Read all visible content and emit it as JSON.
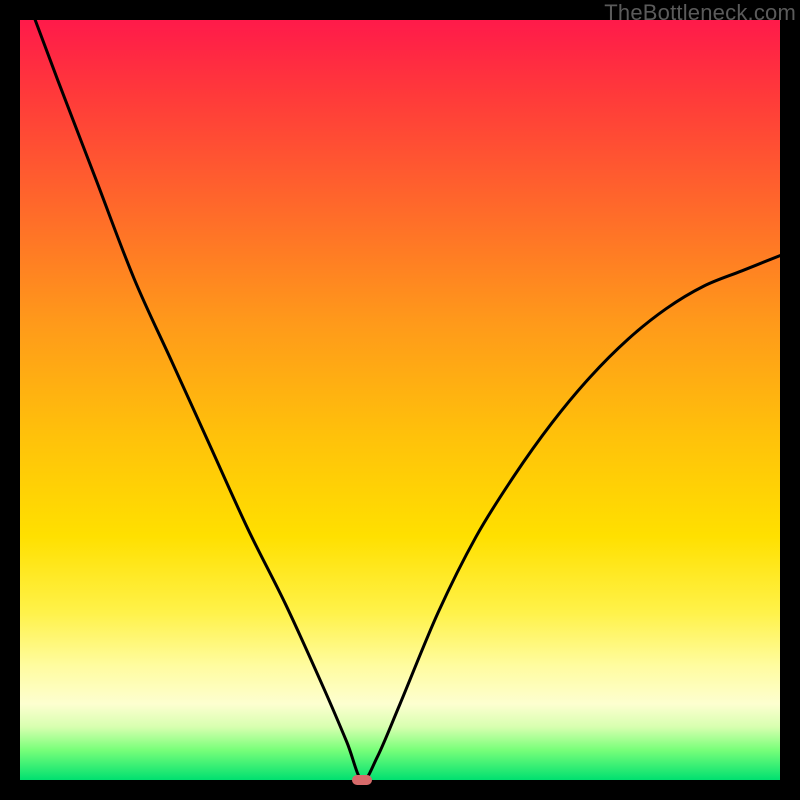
{
  "watermark": "TheBottleneck.com",
  "colors": {
    "frame": "#000000",
    "curve": "#000000",
    "marker": "#d76a6a"
  },
  "chart_data": {
    "type": "line",
    "title": "",
    "xlabel": "",
    "ylabel": "",
    "xlim": [
      0,
      100
    ],
    "ylim": [
      0,
      100
    ],
    "grid": false,
    "legend": false,
    "annotations": [],
    "description": "Bottleneck curve on a rainbow gradient. A black curve descends from the top-left, reaches a minimum near x≈45, and rises to the right edge around y≈70. A small rounded marker sits at the minimum.",
    "series": [
      {
        "name": "bottleneck-curve",
        "x": [
          2,
          5,
          10,
          15,
          20,
          25,
          30,
          35,
          40,
          43,
          45,
          47,
          50,
          55,
          60,
          65,
          70,
          75,
          80,
          85,
          90,
          95,
          100
        ],
        "y": [
          100,
          92,
          79,
          66,
          55,
          44,
          33,
          23,
          12,
          5,
          0,
          3,
          10,
          22,
          32,
          40,
          47,
          53,
          58,
          62,
          65,
          67,
          69
        ]
      }
    ],
    "marker": {
      "x": 45,
      "y": 0
    }
  }
}
